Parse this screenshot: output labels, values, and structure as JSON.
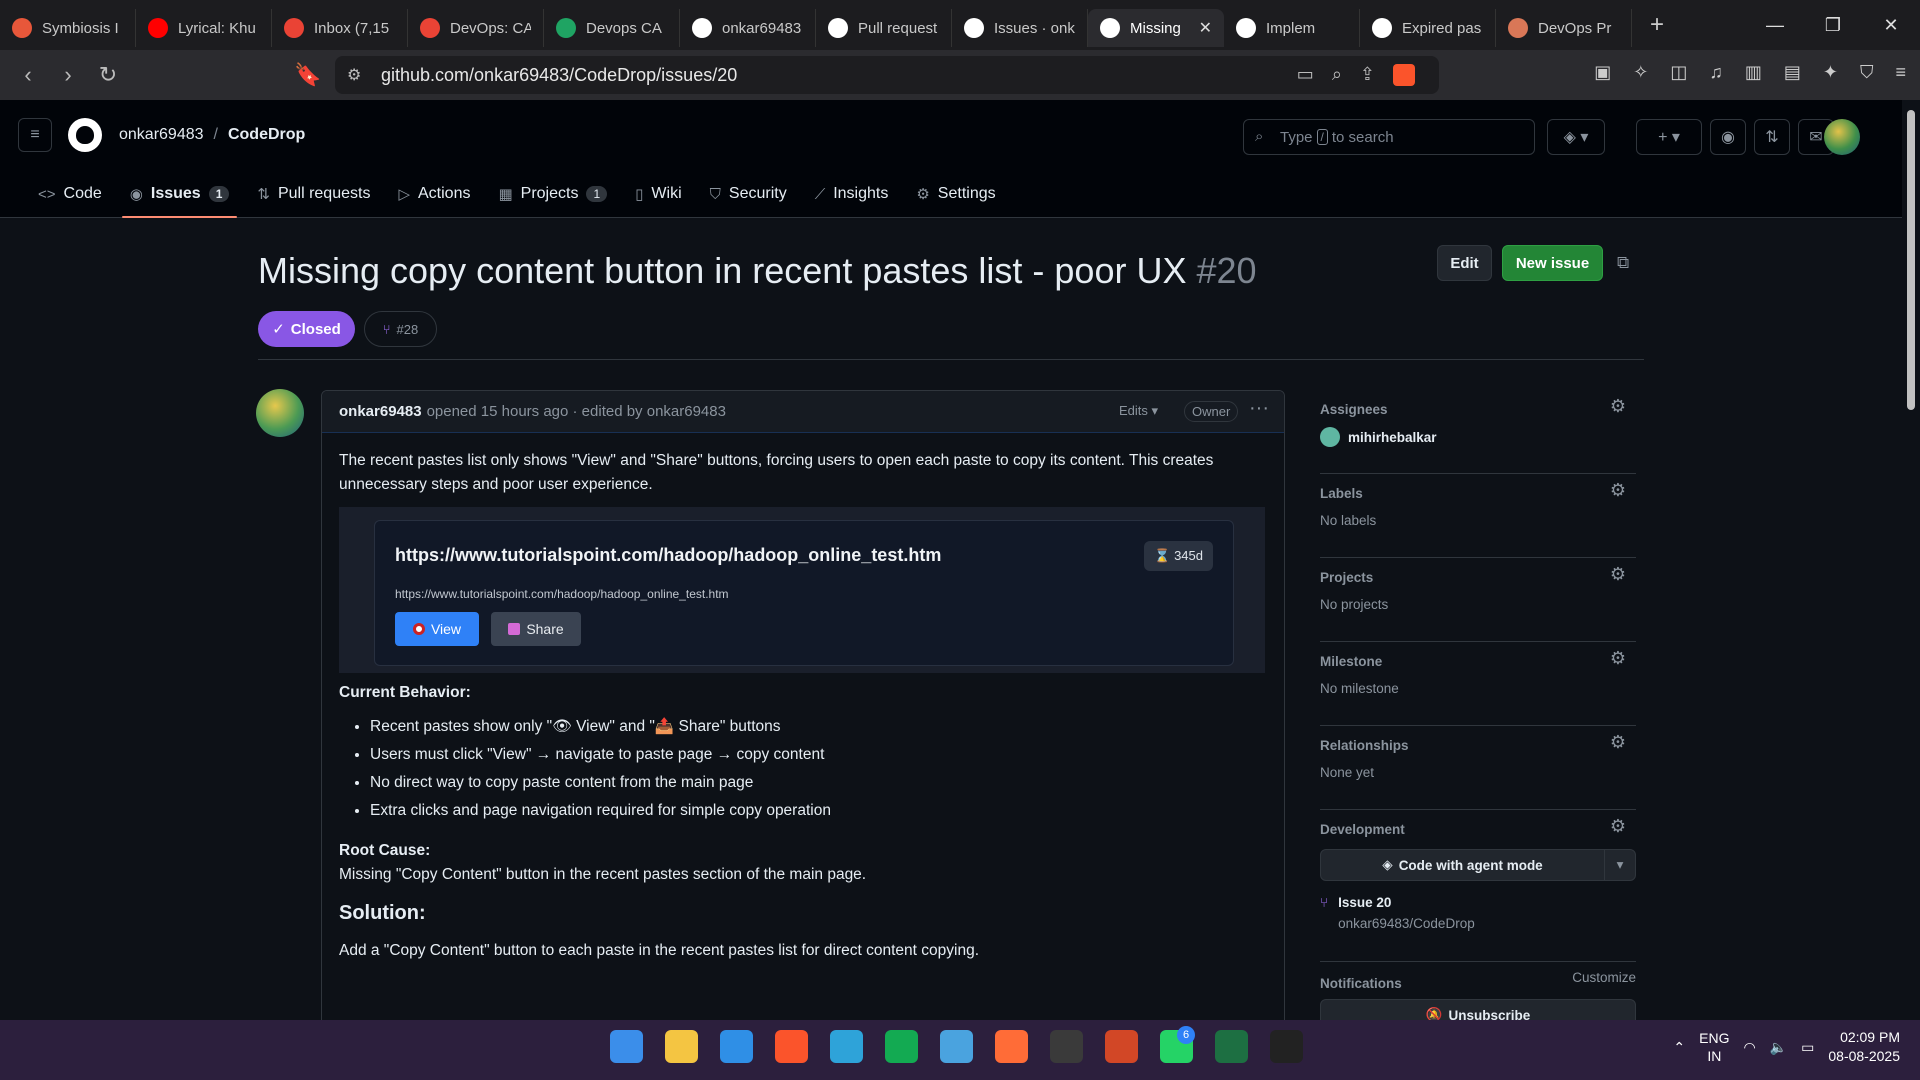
{
  "browser": {
    "tabs": [
      {
        "label": "Symbiosis I",
        "color": "#e8573a"
      },
      {
        "label": "Lyrical: Khu",
        "color": "#ff0000"
      },
      {
        "label": "Inbox (7,15",
        "color": "#ea4335"
      },
      {
        "label": "DevOps: CA",
        "color": "#ea4335"
      },
      {
        "label": "Devops CA",
        "color": "#1fa463"
      },
      {
        "label": "onkar69483",
        "color": "#ffffff"
      },
      {
        "label": "Pull request",
        "color": "#ffffff"
      },
      {
        "label": "Issues · onk",
        "color": "#ffffff"
      },
      {
        "label": "Missing",
        "color": "#ffffff",
        "active": true
      },
      {
        "label": "Implem",
        "color": "#ffffff"
      },
      {
        "label": "Expired pas",
        "color": "#ffffff"
      },
      {
        "label": "DevOps Pr",
        "color": "#d97757"
      }
    ],
    "url": "github.com/onkar69483/CodeDrop/issues/20"
  },
  "header": {
    "owner": "onkar69483",
    "separator": "/",
    "repo": "CodeDrop",
    "search_prefix": "Type",
    "search_key": "/",
    "search_suffix": "to search"
  },
  "repo_nav": [
    {
      "icon": "code-icon",
      "glyph": "<>",
      "label": "Code",
      "count": ""
    },
    {
      "icon": "issue-icon",
      "glyph": "◉",
      "label": "Issues",
      "count": "1",
      "selected": true
    },
    {
      "icon": "pull-request-icon",
      "glyph": "⇅",
      "label": "Pull requests",
      "count": ""
    },
    {
      "icon": "actions-icon",
      "glyph": "▷",
      "label": "Actions",
      "count": ""
    },
    {
      "icon": "projects-icon",
      "glyph": "▦",
      "label": "Projects",
      "count": "1"
    },
    {
      "icon": "wiki-icon",
      "glyph": "▯",
      "label": "Wiki",
      "count": ""
    },
    {
      "icon": "security-icon",
      "glyph": "⛉",
      "label": "Security",
      "count": ""
    },
    {
      "icon": "insights-icon",
      "glyph": "⟋",
      "label": "Insights",
      "count": ""
    },
    {
      "icon": "settings-icon",
      "glyph": "⚙",
      "label": "Settings",
      "count": ""
    }
  ],
  "issue": {
    "title": "Missing copy content button in recent pastes list - poor UX",
    "number": "#20",
    "edit_label": "Edit",
    "new_issue_label": "New issue",
    "state": "Closed",
    "linked_pr": "#28"
  },
  "comment": {
    "author": "onkar69483",
    "meta": "opened 15 hours ago · edited by onkar69483",
    "edits_label": "Edits",
    "owner_badge": "Owner",
    "intro": "The recent pastes list only shows \"View\" and \"Share\" buttons, forcing users to open each paste to copy its content. This creates unnecessary steps and poor user experience.",
    "embed": {
      "title": "https://www.tutorialspoint.com/hadoop/hadoop_online_test.htm",
      "badge": "⌛ 345d",
      "url": "https://www.tutorialspoint.com/hadoop/hadoop_online_test.htm",
      "view_label": "View",
      "share_label": "Share"
    },
    "current_behavior_heading": "Current Behavior:",
    "bullets": [
      "Recent pastes show only \"👁 View\" and \"📤 Share\" buttons",
      "Users must click \"View\" → navigate to paste page → copy content",
      "No direct way to copy paste content from the main page",
      "Extra clicks and page navigation required for simple copy operation"
    ],
    "root_cause_heading": "Root Cause:",
    "root_cause": "Missing \"Copy Content\" button in the recent pastes section of the main page.",
    "solution_heading": "Solution:",
    "solution": "Add a \"Copy Content\" button to each paste in the recent pastes list for direct content copying."
  },
  "sidebar": {
    "assignees_label": "Assignees",
    "assignee": "mihirhebalkar",
    "labels_label": "Labels",
    "labels_value": "No labels",
    "projects_label": "Projects",
    "projects_value": "No projects",
    "milestone_label": "Milestone",
    "milestone_value": "No milestone",
    "relationships_label": "Relationships",
    "relationships_value": "None yet",
    "development_label": "Development",
    "agent_button": "Code with agent mode",
    "dev_issue": "Issue 20",
    "dev_repo": "onkar69483/CodeDrop",
    "notifications_label": "Notifications",
    "customize_label": "Customize",
    "unsubscribe_label": "Unsubscribe"
  },
  "taskbar": {
    "lang1": "ENG",
    "lang2": "IN",
    "time": "02:09 PM",
    "date": "08-08-2025",
    "whatsapp_badge": "6",
    "apps": [
      {
        "name": "start-icon",
        "color": "#3b8eea"
      },
      {
        "name": "file-explorer-icon",
        "color": "#f4c542"
      },
      {
        "name": "vscode-icon",
        "color": "#2f8fe6"
      },
      {
        "name": "brave-icon",
        "color": "#fb542b"
      },
      {
        "name": "edge-icon",
        "color": "#2ea3d9"
      },
      {
        "name": "mongodb-compass-icon",
        "color": "#13aa52"
      },
      {
        "name": "notepad-icon",
        "color": "#4aa3df"
      },
      {
        "name": "postman-icon",
        "color": "#ff6c37"
      },
      {
        "name": "terminal-icon",
        "color": "#3a3a3a"
      },
      {
        "name": "powerpoint-icon",
        "color": "#d24726"
      },
      {
        "name": "whatsapp-icon",
        "color": "#25d366"
      },
      {
        "name": "excel-icon",
        "color": "#1d6f42"
      },
      {
        "name": "app-icon",
        "color": "#222222"
      }
    ]
  }
}
